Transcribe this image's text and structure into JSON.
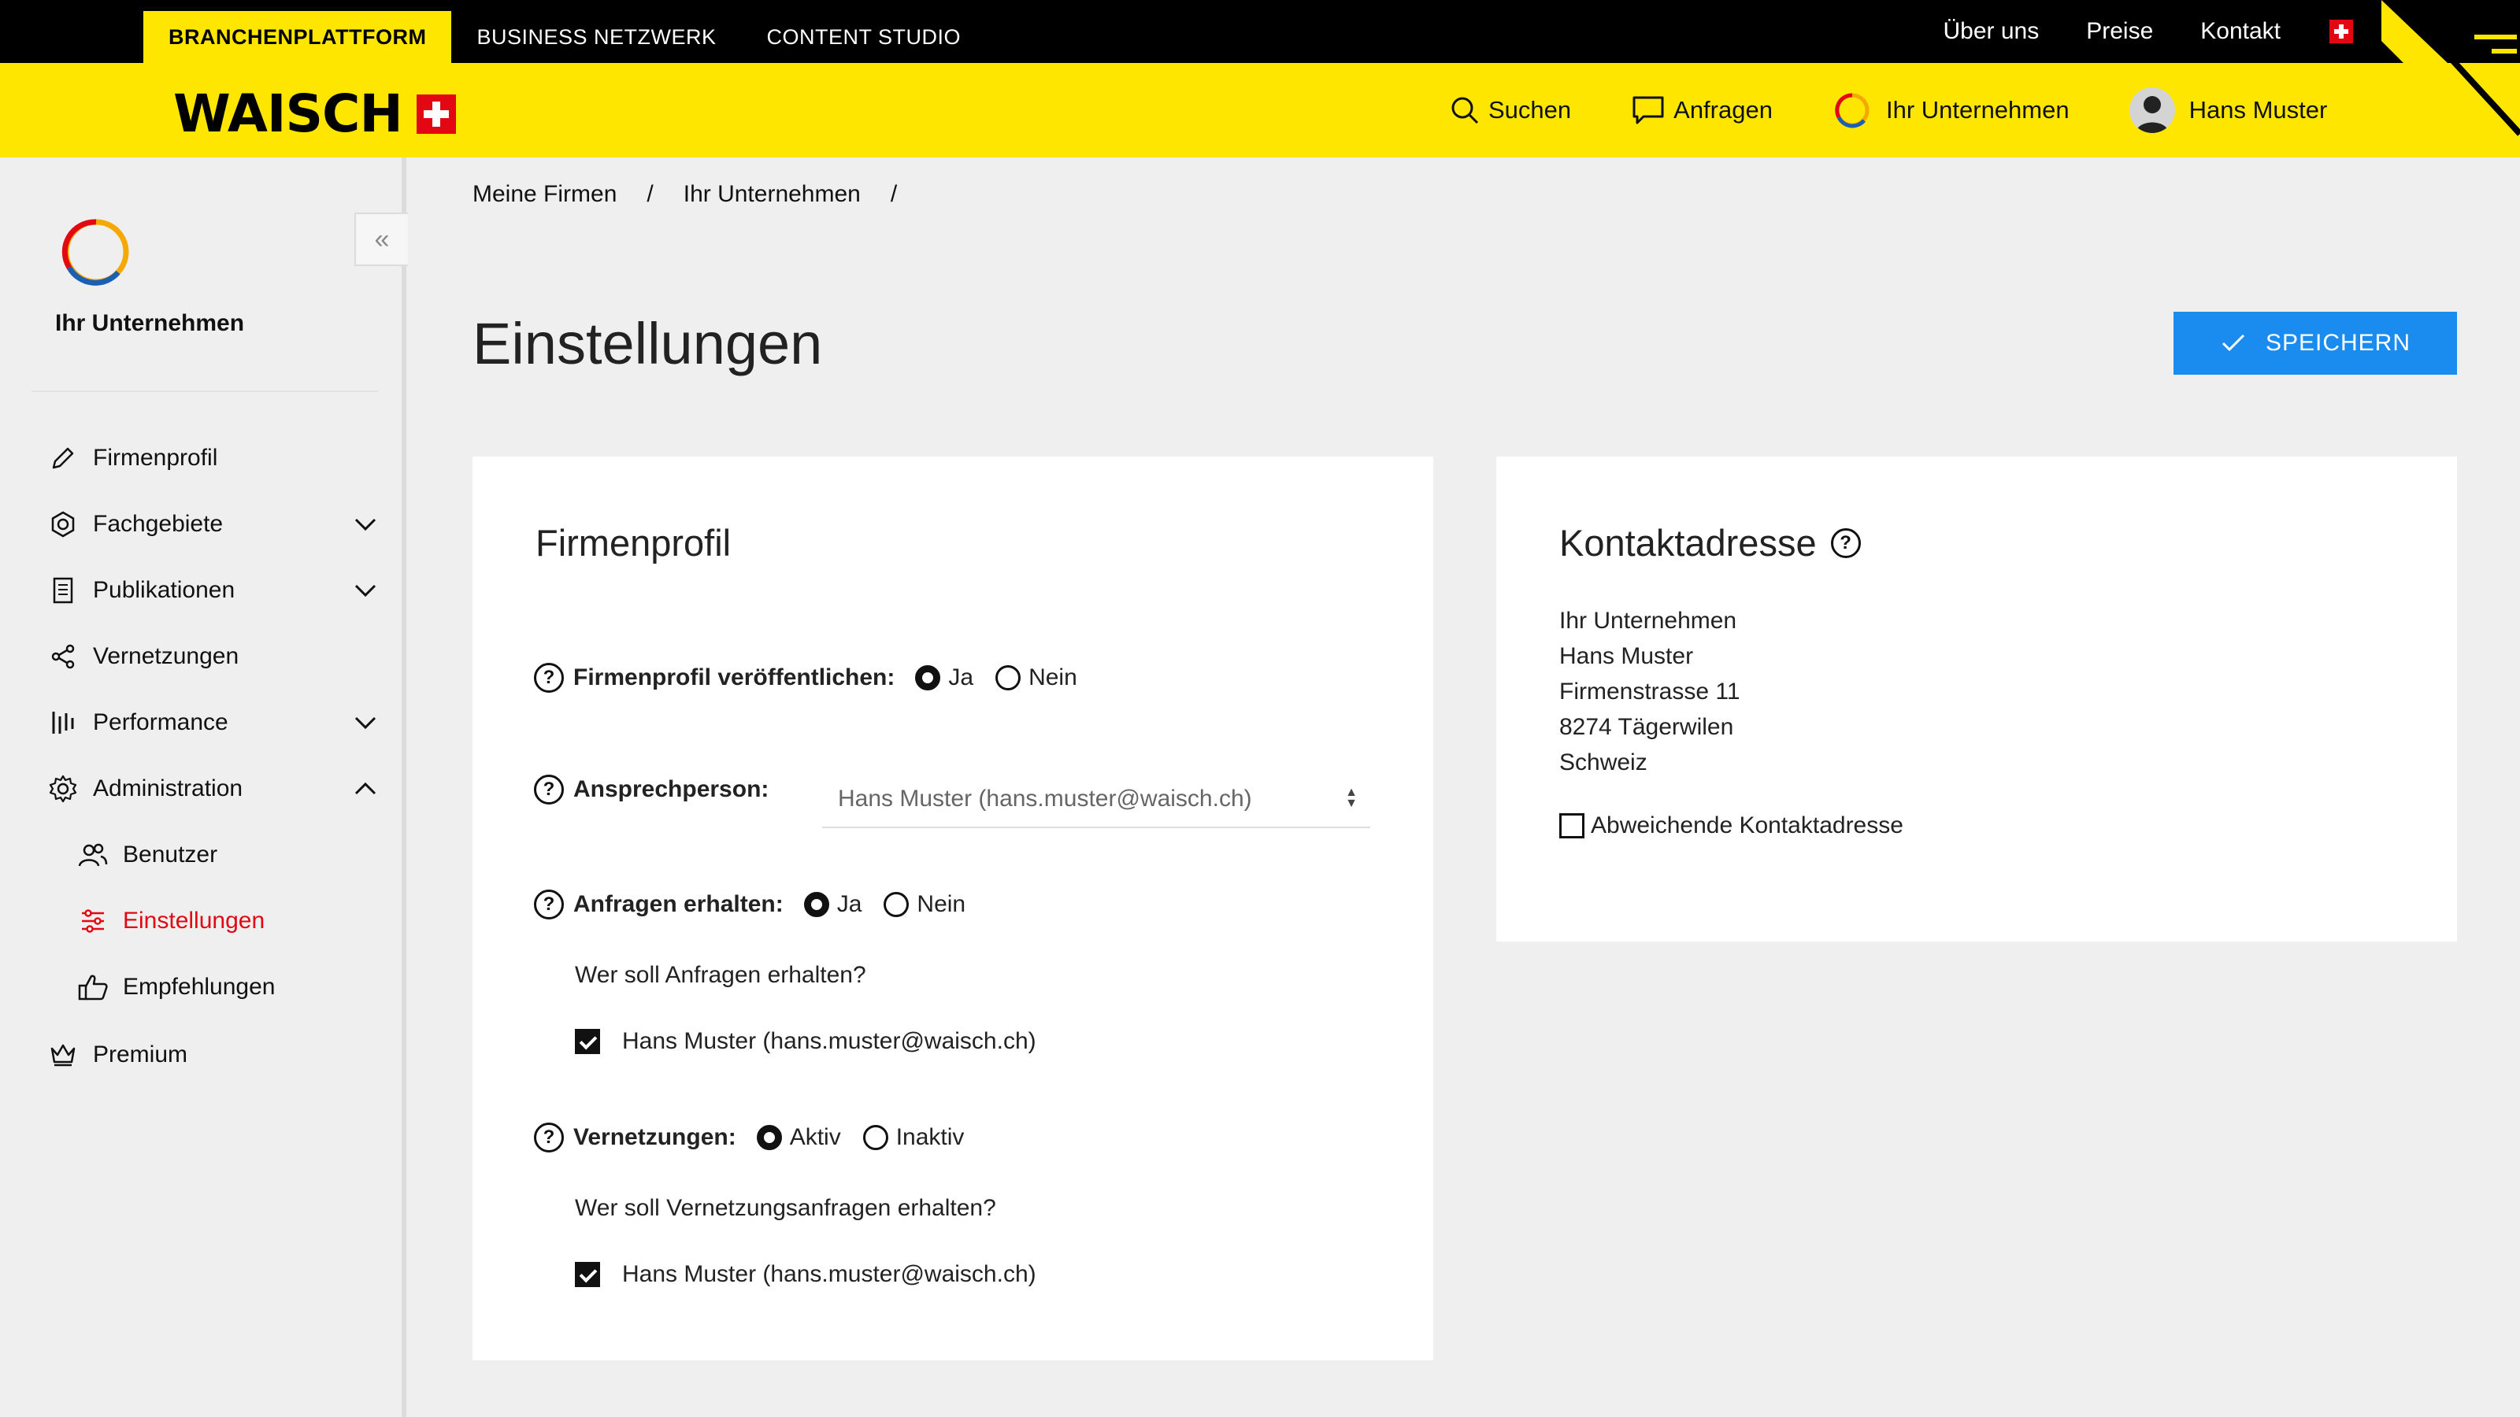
{
  "topbar": {
    "tabs": [
      "BRANCHENPLATTFORM",
      "BUSINESS NETZWERK",
      "CONTENT STUDIO"
    ],
    "links": [
      "Über uns",
      "Preise",
      "Kontakt"
    ]
  },
  "header": {
    "logo": "WAISCH",
    "nav": {
      "search": "Suchen",
      "requests": "Anfragen",
      "company": "Ihr Unternehmen",
      "user": "Hans Muster"
    }
  },
  "sidebar": {
    "company_name": "Ihr Unternehmen",
    "collapse": "«",
    "items": {
      "firmenprofil": "Firmenprofil",
      "fachgebiete": "Fachgebiete",
      "publikationen": "Publikationen",
      "vernetzungen": "Vernetzungen",
      "performance": "Performance",
      "administration": "Administration",
      "benutzer": "Benutzer",
      "einstellungen": "Einstellungen",
      "empfehlungen": "Empfehlungen",
      "premium": "Premium"
    }
  },
  "breadcrumb": [
    "Meine Firmen",
    "/",
    "Ihr Unternehmen",
    "/"
  ],
  "page": {
    "title": "Einstellungen",
    "save_label": "SPEICHERN"
  },
  "firmenprofil": {
    "title": "Firmenprofil",
    "publish_label": "Firmenprofil veröffentlichen:",
    "publish_options": [
      "Ja",
      "Nein"
    ],
    "publish_selected": "Ja",
    "contact_label": "Ansprechperson:",
    "contact_value": "Hans Muster (hans.muster@waisch.ch)",
    "requests_label": "Anfragen erhalten:",
    "requests_options": [
      "Ja",
      "Nein"
    ],
    "requests_selected": "Ja",
    "requests_question": "Wer soll Anfragen erhalten?",
    "requests_recipient": "Hans Muster (hans.muster@waisch.ch)",
    "network_label": "Vernetzungen:",
    "network_options": [
      "Aktiv",
      "Inaktiv"
    ],
    "network_selected": "Aktiv",
    "network_question": "Wer soll Vernetzungsanfragen erhalten?",
    "network_recipient": "Hans Muster (hans.muster@waisch.ch)"
  },
  "kontakt": {
    "title": "Kontaktadresse",
    "address": [
      "Ihr Unternehmen",
      "Hans Muster",
      "Firmenstrasse 11",
      "8274 Tägerwilen",
      "Schweiz"
    ],
    "alt_label": "Abweichende Kontaktadresse"
  },
  "colors": {
    "brand_yellow": "#ffe600",
    "accent_blue": "#1a8cf0",
    "active_red": "#e30613"
  },
  "icons": [
    "search-icon",
    "chat-icon",
    "company-logo-icon",
    "user-avatar-icon",
    "menu-icon",
    "pencil-icon",
    "hexagon-icon",
    "document-icon",
    "share-icon",
    "bars-icon",
    "gear-icon",
    "users-icon",
    "sliders-icon",
    "thumbs-up-icon",
    "crown-icon",
    "help-icon",
    "check-icon"
  ]
}
